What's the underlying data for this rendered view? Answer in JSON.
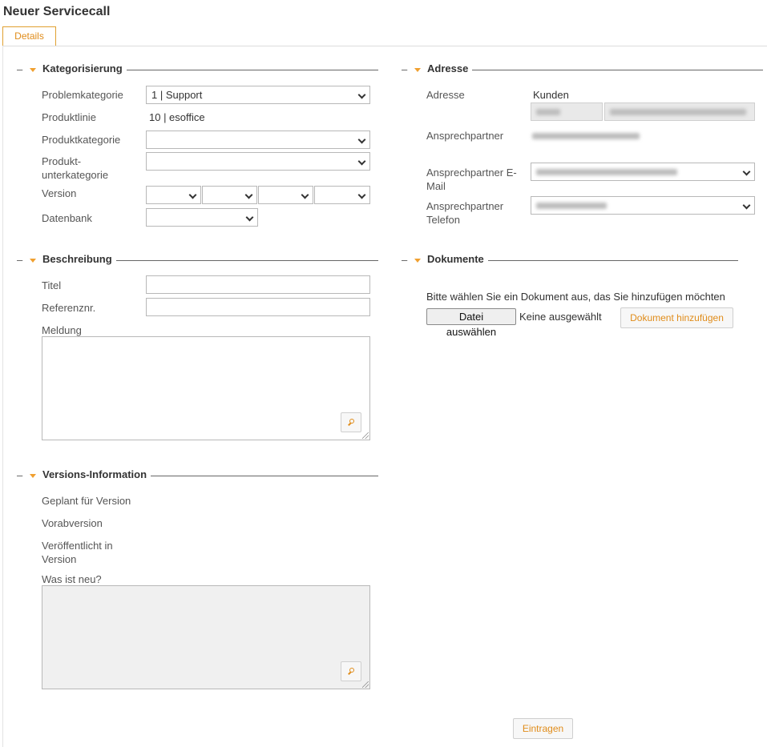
{
  "page": {
    "title": "Neuer Servicecall"
  },
  "tabs": [
    {
      "label": "Details"
    }
  ],
  "sections": {
    "kategorisierung": {
      "title": "Kategorisierung",
      "problemkategorie_label": "Problemkategorie",
      "problemkategorie_value": "1 | Support",
      "produktlinie_label": "Produktlinie",
      "produktlinie_value": "10 | esoffice",
      "produktkategorie_label": "Produktkategorie",
      "produktunterkategorie_label_1": "Produkt-",
      "produktunterkategorie_label_2": "unterkategorie",
      "version_label": "Version",
      "datenbank_label": "Datenbank"
    },
    "beschreibung": {
      "title": "Beschreibung",
      "titel_label": "Titel",
      "referenz_label": "Referenznr.",
      "meldung_label": "Meldung"
    },
    "versions_information": {
      "title": "Versions-Information",
      "geplant_label": "Geplant für Version",
      "vorab_label": "Vorabversion",
      "veroeffentlicht_label_1": "Veröffentlicht in",
      "veroeffentlicht_label_2": "Version",
      "neu_label": "Was ist neu?"
    },
    "adresse": {
      "title": "Adresse",
      "adresse_label": "Adresse",
      "kunden_label": "Kunden",
      "ansprechpartner_label": "Ansprechpartner",
      "email_label_1": "Ansprechpartner E-",
      "email_label_2": "Mail",
      "telefon_label_1": "Ansprechpartner",
      "telefon_label_2": "Telefon"
    },
    "dokumente": {
      "title": "Dokumente",
      "hint": "Bitte wählen Sie ein Dokument aus, das Sie hinzufügen möchten",
      "file_button": "Datei auswählen",
      "file_status": "Keine ausgewählt",
      "add_button": "Dokument hinzufügen"
    }
  },
  "footer": {
    "submit_button": "Eintragen"
  },
  "colors": {
    "accent": "#e08c1a",
    "border": "#b8b8b8"
  },
  "icons": [
    "minus-icon",
    "collapse-triangle-icon",
    "chevron-down-icon",
    "magnifier-icon",
    "resize-grip-icon"
  ]
}
